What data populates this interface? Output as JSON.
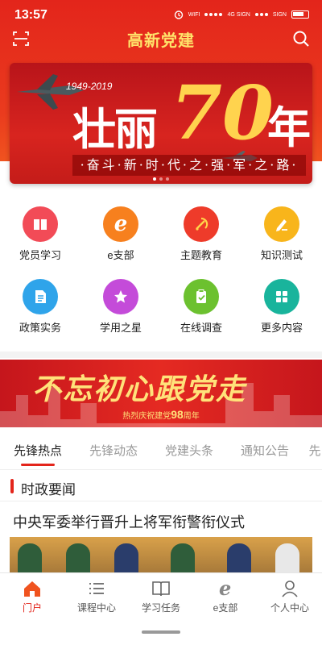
{
  "status_bar": {
    "time": "13:57",
    "wifi": "WIFI",
    "sig1": "4G SIGN",
    "sig2": "SIGN"
  },
  "header": {
    "title": "高新党建"
  },
  "banner": {
    "years": "1949-2019",
    "headline_left": "壮丽",
    "headline_num": "70",
    "headline_right": "年",
    "slogan": "·奋斗·新·时·代·之·强·军·之·路·"
  },
  "menu": [
    {
      "label": "党员学习",
      "icon": "book-icon",
      "color": "#f24b57"
    },
    {
      "label": "e支部",
      "icon": "e-icon",
      "color": "#f7801e"
    },
    {
      "label": "主题教育",
      "icon": "party-emblem-icon",
      "color": "#ee3b2a"
    },
    {
      "label": "知识测试",
      "icon": "pencil-icon",
      "color": "#f8b51b"
    },
    {
      "label": "政策实务",
      "icon": "document-icon",
      "color": "#2fa4ea"
    },
    {
      "label": "学用之星",
      "icon": "star-icon",
      "color": "#c44bd9"
    },
    {
      "label": "在线调查",
      "icon": "clipboard-check-icon",
      "color": "#6cc12f"
    },
    {
      "label": "更多内容",
      "icon": "grid-icon",
      "color": "#19b49c"
    }
  ],
  "banner2": {
    "script": "不忘初心跟党走",
    "sub_prefix": "热烈庆祝建党",
    "sub_num": "98",
    "sub_suffix": "周年"
  },
  "tabs": [
    "先锋热点",
    "先锋动态",
    "党建头条",
    "通知公告",
    "先"
  ],
  "section": {
    "title": "时政要闻"
  },
  "news": {
    "headline": "中央军委举行晋升上将军衔警衔仪式"
  },
  "bottom_nav": [
    {
      "label": "门户",
      "icon": "home-icon",
      "active": true
    },
    {
      "label": "课程中心",
      "icon": "list-icon",
      "active": false
    },
    {
      "label": "学习任务",
      "icon": "open-book-icon",
      "active": false
    },
    {
      "label": "e支部",
      "icon": "e-icon",
      "active": false
    },
    {
      "label": "个人中心",
      "icon": "person-icon",
      "active": false
    }
  ],
  "colors": {
    "primary": "#e3251b",
    "title_gold": "#ffe36a"
  }
}
